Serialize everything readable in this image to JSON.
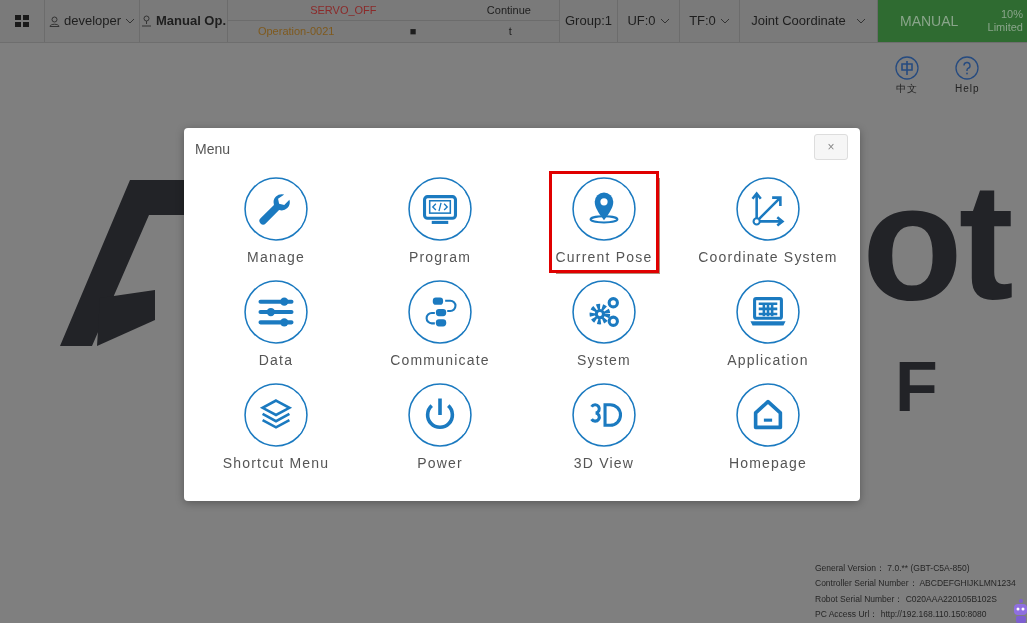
{
  "top_bar": {
    "user": "developer",
    "mode_label": "Manual Op.",
    "servo": "SERVO_OFF",
    "run_mode": "Continue",
    "program": "Operation-0021",
    "stop_symbol": "■",
    "step": "t",
    "group": "Group:1",
    "user_frame": "UF:0",
    "tool_frame": "TF:0",
    "coordinate": "Joint Coordinate",
    "operation_mode": "MANUAL",
    "speed": "10%",
    "speed_state": "Limited"
  },
  "corner_buttons": [
    {
      "label": "中文"
    },
    {
      "label": "Help"
    }
  ],
  "background_logo": {
    "word": "ot",
    "suffix": "F"
  },
  "menu": {
    "title": "Menu",
    "close": "×",
    "items": [
      {
        "label": "Manage",
        "highlighted": false
      },
      {
        "label": "Program",
        "highlighted": false
      },
      {
        "label": "Current Pose",
        "highlighted": true
      },
      {
        "label": "Coordinate System",
        "highlighted": false
      },
      {
        "label": "Data",
        "highlighted": false
      },
      {
        "label": "Communicate",
        "highlighted": false
      },
      {
        "label": "System",
        "highlighted": false
      },
      {
        "label": "Application",
        "highlighted": false
      },
      {
        "label": "Shortcut Menu",
        "highlighted": false
      },
      {
        "label": "Power",
        "highlighted": false
      },
      {
        "label": "3D View",
        "highlighted": false
      },
      {
        "label": "Homepage",
        "highlighted": false
      }
    ]
  },
  "info": [
    {
      "label": "General Version：",
      "value": "7.0.** (GBT-C5A-850)"
    },
    {
      "label": "Controller Serial Number：",
      "value": "ABCDEFGHIJKLMN1234"
    },
    {
      "label": "Robot Serial Number：",
      "value": "C020AAA220105B102S"
    },
    {
      "label": "PC Access Url：",
      "value": "http://192.168.110.150:8080"
    }
  ]
}
